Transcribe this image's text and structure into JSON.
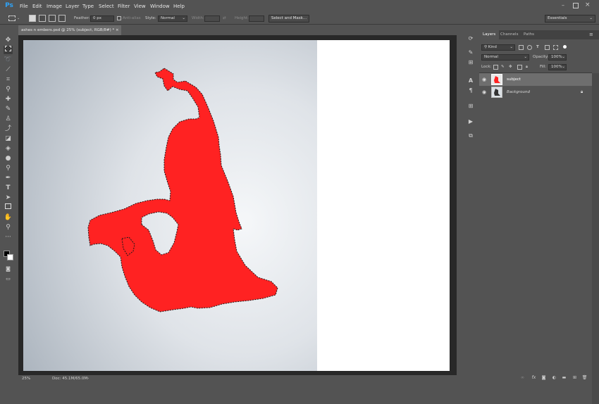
{
  "app": {
    "logo": "Ps"
  },
  "menu": [
    "File",
    "Edit",
    "Image",
    "Layer",
    "Type",
    "Select",
    "Filter",
    "View",
    "Window",
    "Help"
  ],
  "options_bar": {
    "feather_label": "Feather:",
    "feather_value": "0 px",
    "antialias_label": "Anti-alias",
    "style_label": "Style:",
    "style_value": "Normal",
    "width_label": "Width:",
    "height_label": "Height:",
    "select_mask_button": "Select and Mask...",
    "workspace": "Essentials"
  },
  "document": {
    "tab_title": "ashes n embers.psd @ 25% (subject, RGB/8#) *",
    "close_glyph": "×",
    "zoom": "25%",
    "doc_info": "Doc: 45.1M/65.0M"
  },
  "panel": {
    "tabs": [
      "Layers",
      "Channels",
      "Paths"
    ],
    "filter_kind": "Kind",
    "blend_mode": "Normal",
    "opacity_label": "Opacity:",
    "opacity_value": "100%",
    "lock_label": "Lock:",
    "fill_label": "Fill:",
    "fill_value": "100%",
    "layers": [
      {
        "name": "subject",
        "selected": true
      },
      {
        "name": "Background",
        "selected": false,
        "locked": true
      }
    ]
  },
  "colors": {
    "selection_fill": "#ff2222",
    "chrome": "#535353",
    "pasteboard": "#282828"
  }
}
